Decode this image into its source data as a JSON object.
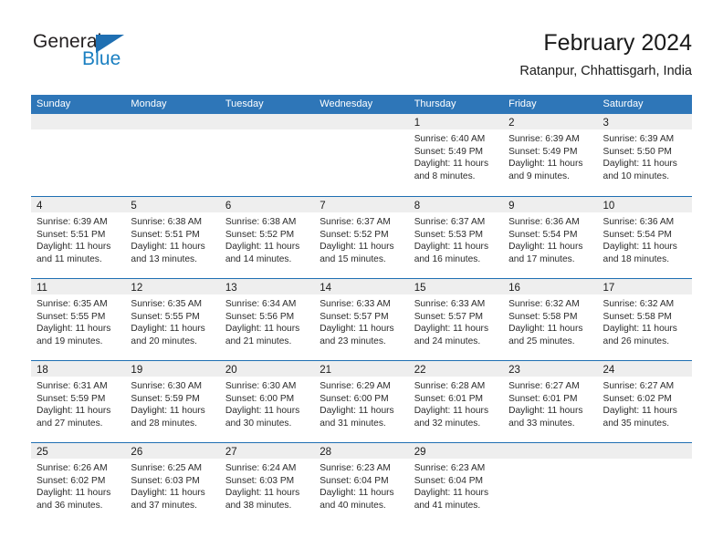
{
  "brand": {
    "name_part1": "General",
    "name_part2": "Blue"
  },
  "header": {
    "title": "February 2024",
    "location": "Ratanpur, Chhattisgarh, India"
  },
  "theme": {
    "header_blue": "#2e76b8",
    "rule_blue": "#1f6fb2",
    "strip_gray": "#eeeeee",
    "brand_blue": "#1a7fc1"
  },
  "weekdays": [
    "Sunday",
    "Monday",
    "Tuesday",
    "Wednesday",
    "Thursday",
    "Friday",
    "Saturday"
  ],
  "weeks": [
    [
      {
        "blank": true
      },
      {
        "blank": true
      },
      {
        "blank": true
      },
      {
        "blank": true
      },
      {
        "date": "1",
        "sunrise": "Sunrise: 6:40 AM",
        "sunset": "Sunset: 5:49 PM",
        "daylight": "Daylight: 11 hours and 8 minutes."
      },
      {
        "date": "2",
        "sunrise": "Sunrise: 6:39 AM",
        "sunset": "Sunset: 5:49 PM",
        "daylight": "Daylight: 11 hours and 9 minutes."
      },
      {
        "date": "3",
        "sunrise": "Sunrise: 6:39 AM",
        "sunset": "Sunset: 5:50 PM",
        "daylight": "Daylight: 11 hours and 10 minutes."
      }
    ],
    [
      {
        "date": "4",
        "sunrise": "Sunrise: 6:39 AM",
        "sunset": "Sunset: 5:51 PM",
        "daylight": "Daylight: 11 hours and 11 minutes."
      },
      {
        "date": "5",
        "sunrise": "Sunrise: 6:38 AM",
        "sunset": "Sunset: 5:51 PM",
        "daylight": "Daylight: 11 hours and 13 minutes."
      },
      {
        "date": "6",
        "sunrise": "Sunrise: 6:38 AM",
        "sunset": "Sunset: 5:52 PM",
        "daylight": "Daylight: 11 hours and 14 minutes."
      },
      {
        "date": "7",
        "sunrise": "Sunrise: 6:37 AM",
        "sunset": "Sunset: 5:52 PM",
        "daylight": "Daylight: 11 hours and 15 minutes."
      },
      {
        "date": "8",
        "sunrise": "Sunrise: 6:37 AM",
        "sunset": "Sunset: 5:53 PM",
        "daylight": "Daylight: 11 hours and 16 minutes."
      },
      {
        "date": "9",
        "sunrise": "Sunrise: 6:36 AM",
        "sunset": "Sunset: 5:54 PM",
        "daylight": "Daylight: 11 hours and 17 minutes."
      },
      {
        "date": "10",
        "sunrise": "Sunrise: 6:36 AM",
        "sunset": "Sunset: 5:54 PM",
        "daylight": "Daylight: 11 hours and 18 minutes."
      }
    ],
    [
      {
        "date": "11",
        "sunrise": "Sunrise: 6:35 AM",
        "sunset": "Sunset: 5:55 PM",
        "daylight": "Daylight: 11 hours and 19 minutes."
      },
      {
        "date": "12",
        "sunrise": "Sunrise: 6:35 AM",
        "sunset": "Sunset: 5:55 PM",
        "daylight": "Daylight: 11 hours and 20 minutes."
      },
      {
        "date": "13",
        "sunrise": "Sunrise: 6:34 AM",
        "sunset": "Sunset: 5:56 PM",
        "daylight": "Daylight: 11 hours and 21 minutes."
      },
      {
        "date": "14",
        "sunrise": "Sunrise: 6:33 AM",
        "sunset": "Sunset: 5:57 PM",
        "daylight": "Daylight: 11 hours and 23 minutes."
      },
      {
        "date": "15",
        "sunrise": "Sunrise: 6:33 AM",
        "sunset": "Sunset: 5:57 PM",
        "daylight": "Daylight: 11 hours and 24 minutes."
      },
      {
        "date": "16",
        "sunrise": "Sunrise: 6:32 AM",
        "sunset": "Sunset: 5:58 PM",
        "daylight": "Daylight: 11 hours and 25 minutes."
      },
      {
        "date": "17",
        "sunrise": "Sunrise: 6:32 AM",
        "sunset": "Sunset: 5:58 PM",
        "daylight": "Daylight: 11 hours and 26 minutes."
      }
    ],
    [
      {
        "date": "18",
        "sunrise": "Sunrise: 6:31 AM",
        "sunset": "Sunset: 5:59 PM",
        "daylight": "Daylight: 11 hours and 27 minutes."
      },
      {
        "date": "19",
        "sunrise": "Sunrise: 6:30 AM",
        "sunset": "Sunset: 5:59 PM",
        "daylight": "Daylight: 11 hours and 28 minutes."
      },
      {
        "date": "20",
        "sunrise": "Sunrise: 6:30 AM",
        "sunset": "Sunset: 6:00 PM",
        "daylight": "Daylight: 11 hours and 30 minutes."
      },
      {
        "date": "21",
        "sunrise": "Sunrise: 6:29 AM",
        "sunset": "Sunset: 6:00 PM",
        "daylight": "Daylight: 11 hours and 31 minutes."
      },
      {
        "date": "22",
        "sunrise": "Sunrise: 6:28 AM",
        "sunset": "Sunset: 6:01 PM",
        "daylight": "Daylight: 11 hours and 32 minutes."
      },
      {
        "date": "23",
        "sunrise": "Sunrise: 6:27 AM",
        "sunset": "Sunset: 6:01 PM",
        "daylight": "Daylight: 11 hours and 33 minutes."
      },
      {
        "date": "24",
        "sunrise": "Sunrise: 6:27 AM",
        "sunset": "Sunset: 6:02 PM",
        "daylight": "Daylight: 11 hours and 35 minutes."
      }
    ],
    [
      {
        "date": "25",
        "sunrise": "Sunrise: 6:26 AM",
        "sunset": "Sunset: 6:02 PM",
        "daylight": "Daylight: 11 hours and 36 minutes."
      },
      {
        "date": "26",
        "sunrise": "Sunrise: 6:25 AM",
        "sunset": "Sunset: 6:03 PM",
        "daylight": "Daylight: 11 hours and 37 minutes."
      },
      {
        "date": "27",
        "sunrise": "Sunrise: 6:24 AM",
        "sunset": "Sunset: 6:03 PM",
        "daylight": "Daylight: 11 hours and 38 minutes."
      },
      {
        "date": "28",
        "sunrise": "Sunrise: 6:23 AM",
        "sunset": "Sunset: 6:04 PM",
        "daylight": "Daylight: 11 hours and 40 minutes."
      },
      {
        "date": "29",
        "sunrise": "Sunrise: 6:23 AM",
        "sunset": "Sunset: 6:04 PM",
        "daylight": "Daylight: 11 hours and 41 minutes."
      },
      {
        "blank": true
      },
      {
        "blank": true
      }
    ]
  ]
}
